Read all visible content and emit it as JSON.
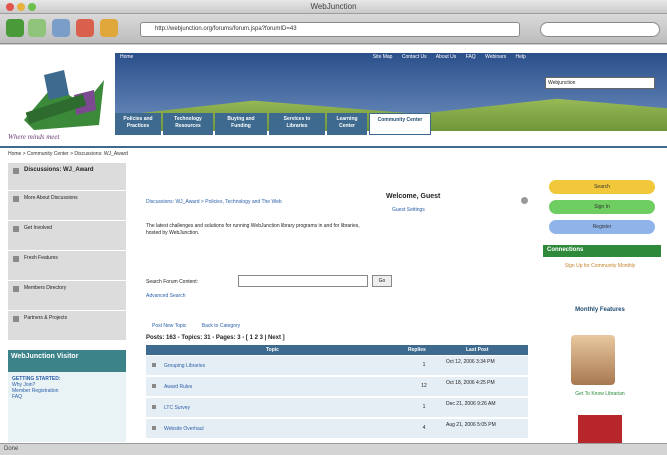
{
  "window": {
    "title": "WebJunction"
  },
  "browser": {
    "url": "http://webjunction.org/forums/forum.jspa?forumID=43"
  },
  "header": {
    "top_links": [
      "Home",
      "Site Map",
      "Contact Us",
      "About Us",
      "FAQ",
      "Webinars",
      "Help"
    ],
    "site_select": "Webjunction",
    "slogan": "Where minds meet"
  },
  "tabs": [
    {
      "label": "Policies and Practices"
    },
    {
      "label": "Technology Resources"
    },
    {
      "label": "Buying and Funding"
    },
    {
      "label": "Services to Libraries"
    },
    {
      "label": "Learning Center"
    },
    {
      "label": "Community Center"
    }
  ],
  "breadcrumb": "Home > Community Center > Discussions: WJ_Award",
  "sidebar": {
    "items": [
      {
        "label": "Discussions: WJ_Award"
      },
      {
        "label": "More About Discussions"
      },
      {
        "label": "Get Involved"
      },
      {
        "label": "Fresh Features"
      },
      {
        "label": "Members Directory"
      },
      {
        "label": "Partners & Projects"
      }
    ],
    "widget_title": "WebJunction Visitor",
    "widget_links": [
      "GETTING STARTED:",
      "Why Join?",
      "Member Registration",
      "FAQ"
    ]
  },
  "main": {
    "forum_path": "Discussions: WJ_Award > Policies, Technology and The Web",
    "description": "The latest challenges and solutions for running WebJunction library programs in and for libraries, hosted by WebJunction.",
    "welcome": "Welcome, Guest",
    "guest_link": "Guest Settings",
    "search_label": "Search Forum Content:",
    "go_label": "Go",
    "advanced_search": "Advanced Search",
    "post_new": "Post New Topic",
    "back": "Back to Category",
    "counts": "Posts: 163 - Topics: 31 - Pages: 3 - [ 1 2 3 | Next ]",
    "col_topic": "Topic",
    "col_replies": "Replies",
    "col_last": "Last Post",
    "threads": [
      {
        "title": "Grouping Libraries",
        "replies": "1",
        "last": "Oct 12, 2006 3:34 PM"
      },
      {
        "title": "Award Rules",
        "replies": "12",
        "last": "Oct 18, 2006 4:25 PM"
      },
      {
        "title": "LTC Survey",
        "replies": "1",
        "last": "Dec 21, 2006 9:26 AM"
      },
      {
        "title": "Website Overhaul",
        "replies": "4",
        "last": "Aug 21, 2006 5:05 PM"
      }
    ]
  },
  "rightcol": {
    "buttons": [
      {
        "label": "Search",
        "color": "#f0c83a"
      },
      {
        "label": "Sign In",
        "color": "#6fce62"
      },
      {
        "label": "Register",
        "color": "#8fb4ea"
      }
    ],
    "connections_title": "Connections",
    "connections_link": "Sign Up for Community Monthly",
    "monthly": "Monthly Features",
    "photo_link": "Get To Know Librarian"
  },
  "status": "Done"
}
